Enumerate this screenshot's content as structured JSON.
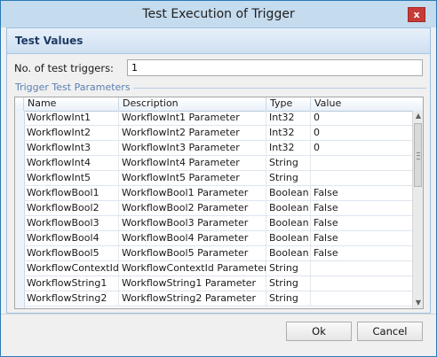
{
  "window": {
    "title": "Test Execution of Trigger",
    "close_label": "x"
  },
  "panel": {
    "title": "Test Values",
    "count_label": "No. of test triggers:",
    "count_value": "1",
    "group_label": "Trigger Test Parameters"
  },
  "grid": {
    "columns": [
      "Name",
      "Description",
      "Type",
      "Value"
    ],
    "rows": [
      {
        "name": "WorkflowInt1",
        "description": "WorkflowInt1 Parameter",
        "type": "Int32",
        "value": "0"
      },
      {
        "name": "WorkflowInt2",
        "description": "WorkflowInt2 Parameter",
        "type": "Int32",
        "value": "0"
      },
      {
        "name": "WorkflowInt3",
        "description": "WorkflowInt3 Parameter",
        "type": "Int32",
        "value": "0"
      },
      {
        "name": "WorkflowInt4",
        "description": "WorkflowInt4 Parameter",
        "type": "String",
        "value": ""
      },
      {
        "name": "WorkflowInt5",
        "description": "WorkflowInt5 Parameter",
        "type": "String",
        "value": ""
      },
      {
        "name": "WorkflowBool1",
        "description": "WorkflowBool1 Parameter",
        "type": "Boolean",
        "value": "False"
      },
      {
        "name": "WorkflowBool2",
        "description": "WorkflowBool2 Parameter",
        "type": "Boolean",
        "value": "False"
      },
      {
        "name": "WorkflowBool3",
        "description": "WorkflowBool3 Parameter",
        "type": "Boolean",
        "value": "False"
      },
      {
        "name": "WorkflowBool4",
        "description": "WorkflowBool4 Parameter",
        "type": "Boolean",
        "value": "False"
      },
      {
        "name": "WorkflowBool5",
        "description": "WorkflowBool5 Parameter",
        "type": "Boolean",
        "value": "False"
      },
      {
        "name": "WorkflowContextId",
        "description": "WorkflowContextId Parameter",
        "type": "String",
        "value": ""
      },
      {
        "name": "WorkflowString1",
        "description": "WorkflowString1 Parameter",
        "type": "String",
        "value": ""
      },
      {
        "name": "WorkflowString2",
        "description": "WorkflowString2 Parameter",
        "type": "String",
        "value": ""
      }
    ]
  },
  "buttons": {
    "ok_label": "Ok",
    "cancel_label": "Cancel"
  },
  "colors": {
    "title_bar": "#c5dbee",
    "panel_header": "#d6e6f5",
    "group_label": "#5a7fb3",
    "close_button": "#c63a37"
  },
  "icons": {
    "close": "close-icon",
    "scroll_up": "scroll-up-arrow-icon",
    "scroll_down": "scroll-down-arrow-icon"
  }
}
